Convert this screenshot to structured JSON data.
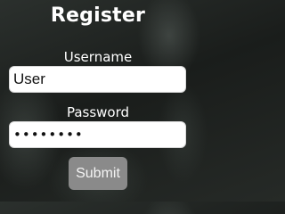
{
  "form": {
    "title": "Register",
    "username_label": "Username",
    "username_value": "User",
    "password_label": "Password",
    "password_value": "password",
    "submit_label": "Submit"
  },
  "colors": {
    "button_background": "#8a8a8a",
    "text": "#ffffff",
    "field_background": "#ffffff"
  }
}
